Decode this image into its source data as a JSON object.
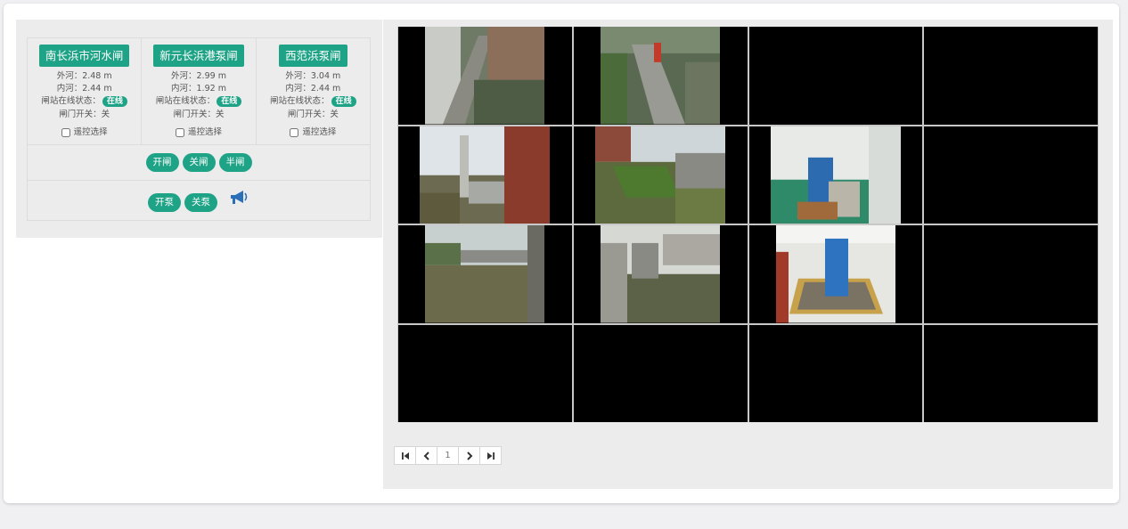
{
  "stations": [
    {
      "name": "南长浜市河水闸",
      "outer": "外河：2.48 m",
      "inner": "内河：2.44 m",
      "status_label": "闸站在线状态：",
      "status_badge": "在线",
      "gate": "闸门开关：关",
      "remote": "遥控选择"
    },
    {
      "name": "新元长浜港泵闸",
      "outer": "外河：2.99 m",
      "inner": "内河：1.92 m",
      "status_label": "闸站在线状态：",
      "status_badge": "在线",
      "gate": "闸门开关：关",
      "remote": "遥控选择"
    },
    {
      "name": "西范浜泵闸",
      "outer": "外河：3.04 m",
      "inner": "内河：2.44 m",
      "status_label": "闸站在线状态：",
      "status_badge": "在线",
      "gate": "闸门开关：关",
      "remote": "遥控选择"
    }
  ],
  "gate_buttons": {
    "open": "开闸",
    "close": "关闸",
    "half": "半闸"
  },
  "pump_buttons": {
    "open": "开泵",
    "close": "关泵"
  },
  "icons": {
    "broadcast": "megaphone-icon",
    "first": "first-page-icon",
    "prev": "prev-page-icon",
    "next": "next-page-icon",
    "last": "last-page-icon"
  },
  "pager": {
    "page": "1"
  },
  "colors": {
    "accent": "#1fa386",
    "megaphone": "#2a6fb8"
  }
}
